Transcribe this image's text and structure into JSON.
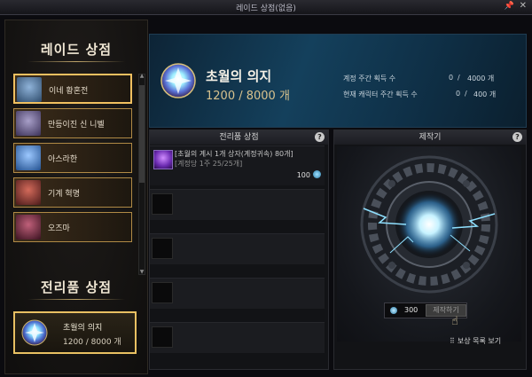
{
  "window": {
    "title": "레이드 상점(없음)",
    "pin_icon": "pin-icon",
    "close_icon": "close-icon"
  },
  "left": {
    "raid_title": "레이드 상점",
    "raids": [
      {
        "label": "이네 황혼전",
        "color": "#5a7a9a"
      },
      {
        "label": "만등이진 신 니벨",
        "color": "#6a5a8a"
      },
      {
        "label": "아스라한",
        "color": "#3f6fb8"
      },
      {
        "label": "기계 혁명",
        "color": "#8a2a2a"
      },
      {
        "label": "오즈마",
        "color": "#7a2a3a"
      }
    ],
    "trophy_title": "전리품 상점",
    "trophy": {
      "name": "초월의 의지",
      "count": "1200 / 8000 개"
    }
  },
  "banner": {
    "name": "초월의 의지",
    "count": "1200 / 8000 개",
    "stats": [
      {
        "label": "계정 주간 획득 수",
        "current": "0",
        "max": "4000 개"
      },
      {
        "label": "현재 캐릭터 주간 획득 수",
        "current": "0",
        "max": "400 개"
      }
    ],
    "stat_sep": "/"
  },
  "trophy_shop": {
    "title": "전리품 상점",
    "help": "?",
    "items": [
      {
        "line1": "[초월의 계시 1개 상자(계정귀속) 80개]",
        "line2": "[계정당 1주 25/25개]",
        "price": "100"
      }
    ]
  },
  "workbench": {
    "title": "제작기",
    "help": "?",
    "cost": "300",
    "craft_button": "제작하기",
    "reward_link": "보상 목록 보기"
  }
}
